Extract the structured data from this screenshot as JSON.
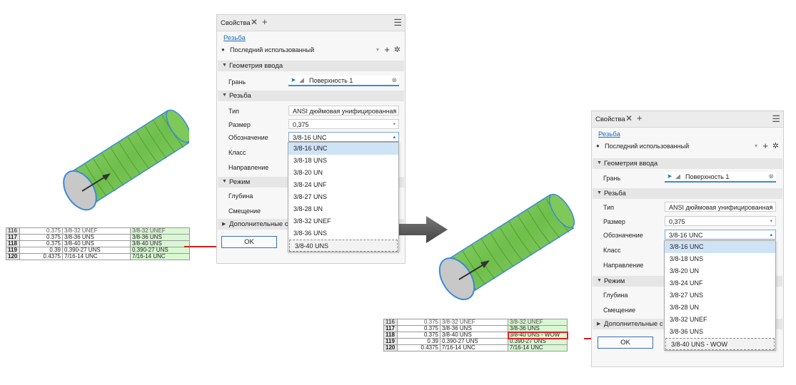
{
  "colors": {
    "accent": "#1a6fc4",
    "thread_green": "#7fc85a",
    "highlight_red": "#cc1f1f",
    "sheet_green": "#d9f7d3"
  },
  "before": {
    "panel": {
      "tab_title": "Свойства",
      "tab_close": "✕",
      "tab_add": "+",
      "menu_icon": "☰",
      "feature_link": "Резьба",
      "preset": "Последний использованный",
      "preset_icon": "●",
      "preset_caret": "▾",
      "preset_add": "+",
      "preset_gear": "✲",
      "sections": {
        "input_geometry": "Геометрия ввода",
        "thread": "Резьба",
        "mode": "Режим",
        "advanced": "Дополнительные св"
      },
      "face_label": "Грань",
      "face_value": "Поверхность 1",
      "labels": {
        "type": "Тип",
        "size": "Размер",
        "designation": "Обозначение",
        "class": "Класс",
        "direction": "Направление",
        "depth": "Глубина",
        "offset": "Смещение"
      },
      "values": {
        "type": "ANSI дюймовая унифицированная",
        "size": "0,375",
        "designation": "3/8-16 UNC"
      },
      "dropdown_options": [
        "3/8-16 UNC",
        "3/8-18 UNS",
        "3/8-20 UN",
        "3/8-24 UNF",
        "3/8-27 UNS",
        "3/8-28 UN",
        "3/8-32 UNEF",
        "3/8-36 UNS",
        "3/8-40 UNS"
      ],
      "ok_label": "OK"
    },
    "sheet": [
      {
        "row": "116",
        "size": "0.375",
        "designation": "3/8-32 UNEF",
        "custom": "3/8-32 UNEF"
      },
      {
        "row": "117",
        "size": "0.375",
        "designation": "3/8-36 UNS",
        "custom": "3/8-36 UNS"
      },
      {
        "row": "118",
        "size": "0.375",
        "designation": "3/8-40 UNS",
        "custom": "3/8-40 UNS"
      },
      {
        "row": "119",
        "size": "0.39",
        "designation": "0.390-27 UNS",
        "custom": "0.390-27 UNS"
      },
      {
        "row": "120",
        "size": "0.4375",
        "designation": "7/16-14 UNC",
        "custom": "7/16-14 UNC"
      }
    ]
  },
  "after": {
    "panel": {
      "tab_title": "Свойства",
      "tab_close": "✕",
      "tab_add": "+",
      "menu_icon": "☰",
      "feature_link": "Резьба",
      "preset": "Последний использованный",
      "preset_icon": "●",
      "preset_caret": "▾",
      "preset_add": "+",
      "preset_gear": "✲",
      "sections": {
        "input_geometry": "Геометрия ввода",
        "thread": "Резьба",
        "mode": "Режим",
        "advanced": "Дополнительные с"
      },
      "face_label": "Грань",
      "face_value": "Поверхность 1",
      "labels": {
        "type": "Тип",
        "size": "Размер",
        "designation": "Обозначение",
        "class": "Класс",
        "direction": "Направление",
        "depth": "Глубина",
        "offset": "Смещение"
      },
      "values": {
        "type": "ANSI дюймовая унифицированная",
        "size": "0,375",
        "designation": "3/8-16 UNC"
      },
      "dropdown_options": [
        "3/8-16 UNC",
        "3/8-18 UNS",
        "3/8-20 UN",
        "3/8-24 UNF",
        "3/8-27 UNS",
        "3/8-28 UN",
        "3/8-32 UNEF",
        "3/8-36 UNS",
        "3/8-40 UNS - WOW"
      ],
      "ok_label": "OK"
    },
    "sheet": [
      {
        "row": "116",
        "size": "0.375",
        "designation": "3/8-32 UNEF",
        "custom": "3/8-32 UNEF"
      },
      {
        "row": "117",
        "size": "0.375",
        "designation": "3/8-36 UNS",
        "custom": "3/8-36 UNS"
      },
      {
        "row": "118",
        "size": "0.375",
        "designation": "3/8-40 UNS",
        "custom": "3/8-40 UNS - WOW"
      },
      {
        "row": "119",
        "size": "0.39",
        "designation": "0.390-27 UNS",
        "custom": "0.390-27 UNS"
      },
      {
        "row": "120",
        "size": "0.4375",
        "designation": "7/16-14 UNC",
        "custom": "7/16-14 UNC"
      }
    ]
  }
}
